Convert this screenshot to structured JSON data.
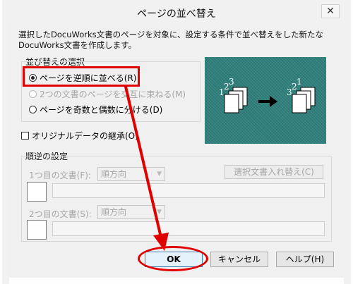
{
  "window": {
    "title": "ページの並べ替え",
    "close_symbol": "✕"
  },
  "description": "選択したDocuWorks文書のページを対象に、設定する条件で並べ替えをした新たなDocuWorks文書を作成します。",
  "sort_group": {
    "label": "並び替えの選択",
    "options": [
      {
        "label": "ページを逆順に並べる(R)",
        "checked": true,
        "enabled": true
      },
      {
        "label": "2つの文書のページを交互に束ねる(M)",
        "checked": false,
        "enabled": false
      },
      {
        "label": "ページを奇数と偶数に分ける(D)",
        "checked": false,
        "enabled": true
      }
    ]
  },
  "preview": {
    "left_digits": [
      "1",
      "2",
      "3"
    ],
    "right_digits": [
      "3",
      "2",
      "1"
    ]
  },
  "keep_original": {
    "label": "オリジナルデータの継承(O)",
    "checked": false
  },
  "reverse_group": {
    "label": "順逆の設定",
    "doc1_label": "1つ目の文書(F):",
    "doc1_order": "順方向",
    "swap_button": "選択文書入れ替え(C)",
    "doc2_label": "2つ目の文書(S):",
    "doc2_order": "順方向"
  },
  "buttons": {
    "ok": "OK",
    "cancel": "キャンセル",
    "help": "ヘルプ(H)"
  },
  "colors": {
    "annotation_red": "#e00000",
    "preview_bg": "#2e7f7b"
  }
}
